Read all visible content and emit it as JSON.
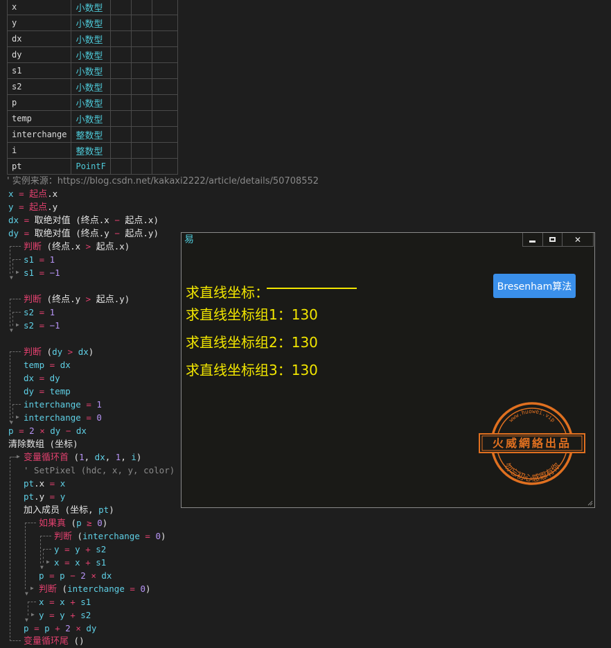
{
  "var_table": {
    "rows": [
      {
        "name": "x",
        "type": "小数型"
      },
      {
        "name": "y",
        "type": "小数型"
      },
      {
        "name": "dx",
        "type": "小数型"
      },
      {
        "name": "dy",
        "type": "小数型"
      },
      {
        "name": "s1",
        "type": "小数型"
      },
      {
        "name": "s2",
        "type": "小数型"
      },
      {
        "name": "p",
        "type": "小数型"
      },
      {
        "name": "temp",
        "type": "小数型"
      },
      {
        "name": "interchange",
        "type": "整数型"
      },
      {
        "name": "i",
        "type": "整数型"
      },
      {
        "name": "pt",
        "type": "PointF"
      }
    ]
  },
  "code": {
    "comment_source": "' 实例来源：https://blog.csdn.net/kakaxi2222/article/details/50708552",
    "pixel_comment": "' SetPixel (hdc, x, y, color)",
    "kw_judge": "判断",
    "kw_if_true": "如果真",
    "kw_loop_start": "变量循环首",
    "kw_loop_end": "变量循环尾",
    "fn_abs": "取绝对值",
    "fn_clear": "清除数组",
    "fn_add": "加入成员",
    "start_point": "起点",
    "end_point": "终点",
    "coord": "坐标"
  },
  "window": {
    "app_icon": "易",
    "minimize_icon": "minimize-icon",
    "maximize_icon": "maximize-icon",
    "close_icon": "close-icon",
    "close_glyph": "✕",
    "title_label": "求直线坐标：",
    "group1": "求直线坐标组1：130",
    "group2": "求直线坐标组2：130",
    "group3": "求直线坐标组3：130",
    "button_label": "Bresenham算法",
    "stamp": {
      "top_text": "www.huowei.vip",
      "banner": "火威網絡出品",
      "bottom_text": "勿忘初心感恩有你"
    }
  },
  "colors": {
    "background": "#1e1e1e",
    "keyword": "#e0406e",
    "variable": "#5fd0e6",
    "number": "#b794f6",
    "yellow_text": "#f2e600",
    "button": "#3a8fea",
    "stamp": "#e07020"
  }
}
